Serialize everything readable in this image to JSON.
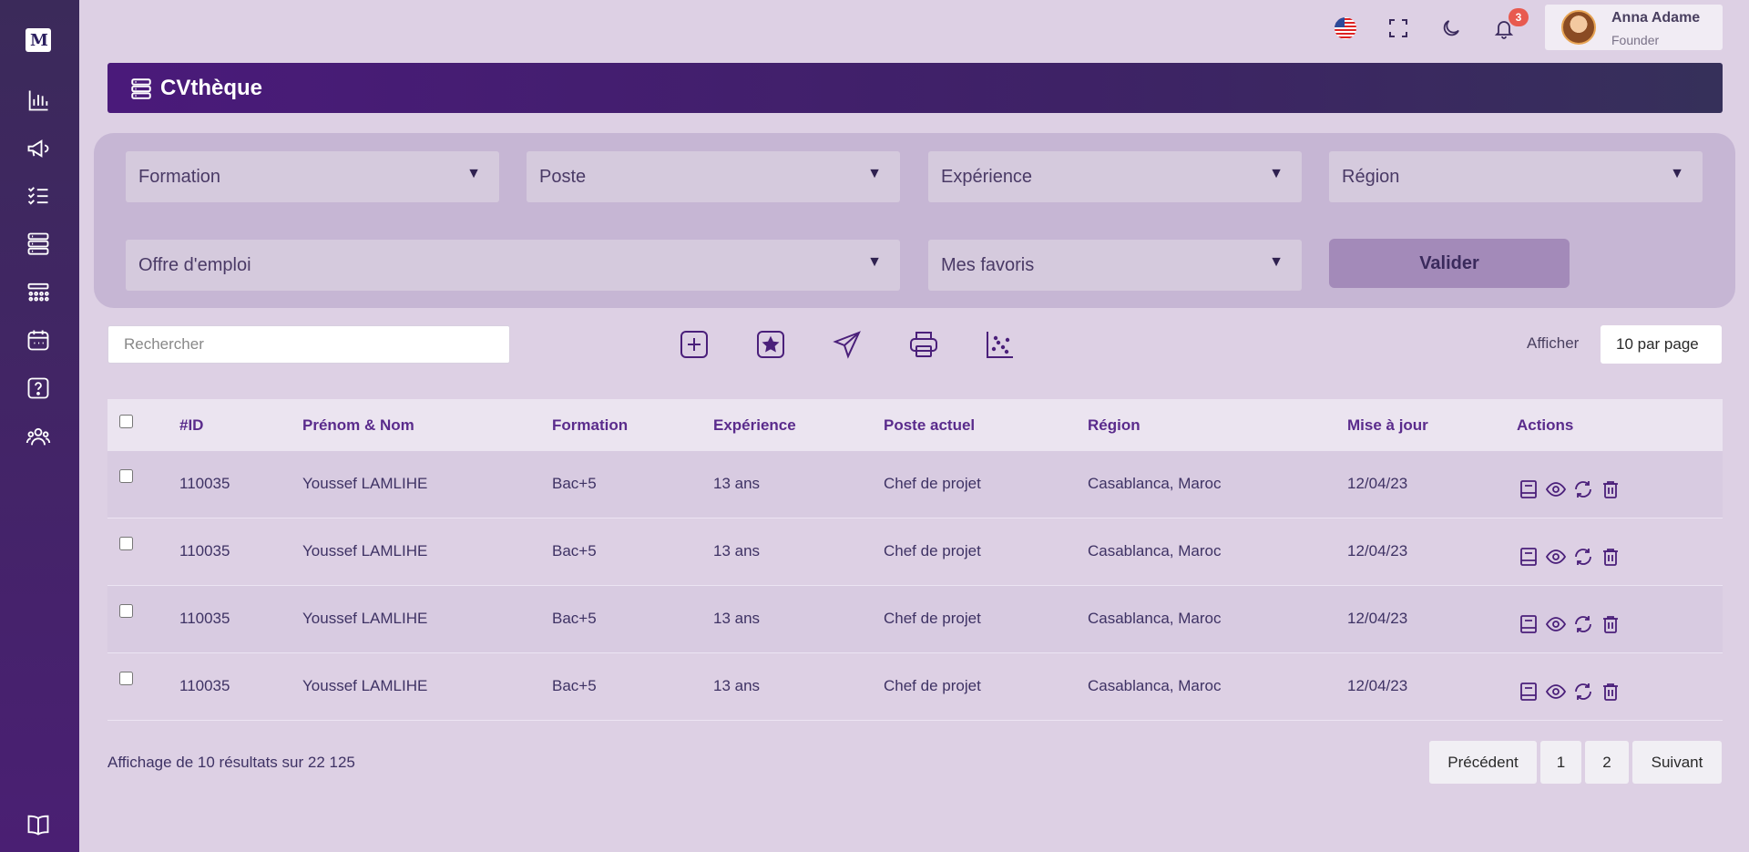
{
  "app": {
    "logo_text": "M"
  },
  "sidebar": {
    "items": [
      {
        "name": "sidebar-item-stats",
        "icon": "bar-chart-icon"
      },
      {
        "name": "sidebar-item-campaigns",
        "icon": "megaphone-icon"
      },
      {
        "name": "sidebar-item-tasks",
        "icon": "checklist-icon"
      },
      {
        "name": "sidebar-item-cvtheque",
        "icon": "database-icon"
      },
      {
        "name": "sidebar-item-grid",
        "icon": "grid-icon"
      },
      {
        "name": "sidebar-item-calendar",
        "icon": "calendar-icon"
      },
      {
        "name": "sidebar-item-help",
        "icon": "question-icon"
      },
      {
        "name": "sidebar-item-users",
        "icon": "users-icon"
      }
    ],
    "bottom_icon": "book-icon"
  },
  "topbar": {
    "notifications_count": "3",
    "user": {
      "name": "Anna Adame",
      "role": "Founder"
    }
  },
  "header": {
    "title": "CVthèque"
  },
  "filters": {
    "formation": "Formation",
    "poste": "Poste",
    "experience": "Expérience",
    "region": "Région",
    "offre": "Offre d'emploi",
    "favoris": "Mes favoris",
    "validate_label": "Valider"
  },
  "toolbar": {
    "search_placeholder": "Rechercher",
    "show_label": "Afficher",
    "per_page": "10 par page"
  },
  "table": {
    "headers": [
      "#ID",
      "Prénom & Nom",
      "Formation",
      "Expérience",
      "Poste actuel",
      "Région",
      "Mise à jour",
      "Actions"
    ],
    "rows": [
      {
        "id": "110035",
        "name": "Youssef LAMLIHE",
        "formation": "Bac+5",
        "experience": "13 ans",
        "poste": "Chef de projet",
        "region": "Casablanca, Maroc",
        "updated": "12/04/23"
      },
      {
        "id": "110035",
        "name": "Youssef LAMLIHE",
        "formation": "Bac+5",
        "experience": "13 ans",
        "poste": "Chef de projet",
        "region": "Casablanca, Maroc",
        "updated": "12/04/23"
      },
      {
        "id": "110035",
        "name": "Youssef LAMLIHE",
        "formation": "Bac+5",
        "experience": "13 ans",
        "poste": "Chef de projet",
        "region": "Casablanca, Maroc",
        "updated": "12/04/23"
      },
      {
        "id": "110035",
        "name": "Youssef LAMLIHE",
        "formation": "Bac+5",
        "experience": "13 ans",
        "poste": "Chef de projet",
        "region": "Casablanca, Maroc",
        "updated": "12/04/23"
      }
    ]
  },
  "footer": {
    "summary": "Affichage de 10 résultats sur 22 125",
    "prev": "Précédent",
    "page1": "1",
    "page2": "2",
    "next": "Suivant"
  }
}
